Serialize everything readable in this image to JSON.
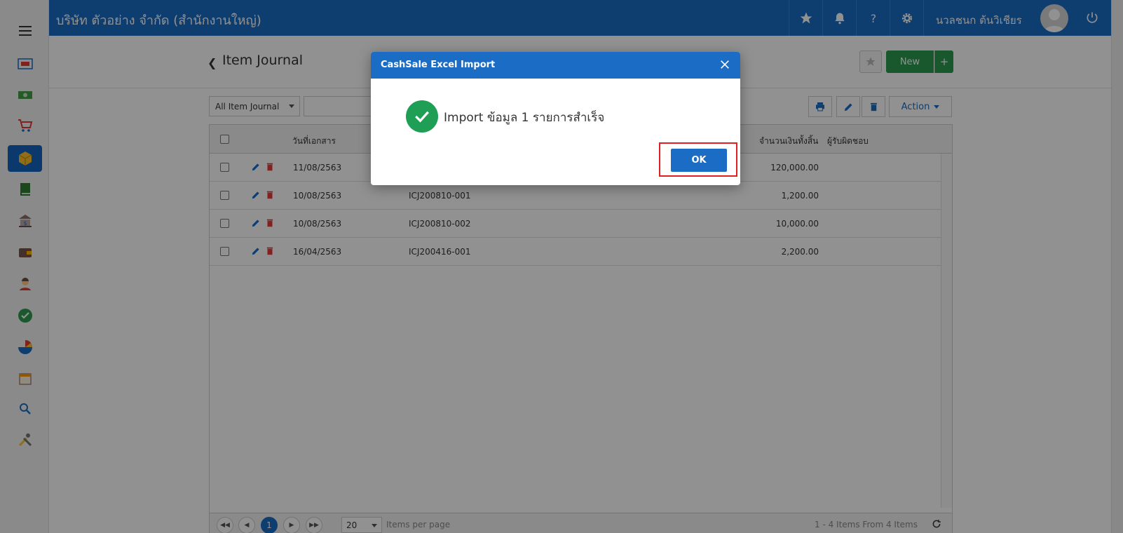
{
  "topbar": {
    "company": "บริษัท ตัวอย่าง จำกัด (สำนักงานใหญ่)",
    "username": "นวลชนก ต้นวิเชียร"
  },
  "sidebar": {
    "items": [
      {
        "icon": "dashboard-icon"
      },
      {
        "icon": "money-icon"
      },
      {
        "icon": "cart-icon"
      },
      {
        "icon": "box-icon",
        "active": true
      },
      {
        "icon": "book-icon"
      },
      {
        "icon": "bank-icon"
      },
      {
        "icon": "wallet-icon"
      },
      {
        "icon": "person-icon"
      },
      {
        "icon": "check-circle-icon"
      },
      {
        "icon": "chart-icon"
      },
      {
        "icon": "calendar-icon"
      },
      {
        "icon": "search-icon"
      },
      {
        "icon": "tools-icon"
      }
    ]
  },
  "header": {
    "title": "Item Journal",
    "new_label": "New",
    "plus_label": "+"
  },
  "toolbar": {
    "filter": "All Item Journal",
    "action_label": "Action"
  },
  "grid": {
    "columns": {
      "date": "วันที่เอกสาร",
      "total": "จำนวนเงินทั้งสิ้น",
      "owner": "ผู้รับผิดชอบ"
    },
    "rows": [
      {
        "date": "11/08/2563",
        "doc": "",
        "total": "120,000.00"
      },
      {
        "date": "10/08/2563",
        "doc": "ICJ200810-001",
        "total": "1,200.00"
      },
      {
        "date": "10/08/2563",
        "doc": "ICJ200810-002",
        "total": "10,000.00"
      },
      {
        "date": "16/04/2563",
        "doc": "ICJ200416-001",
        "total": "2,200.00"
      }
    ]
  },
  "pager": {
    "current_page": "1",
    "per_page": "20",
    "per_page_label": "Items per page",
    "summary": "1 - 4 Items From 4 Items"
  },
  "dialog": {
    "title": "CashSale Excel Import",
    "message": "Import ข้อมูล 1 รายการสำเร็จ",
    "ok_label": "OK"
  },
  "colors": {
    "primary": "#1a6cc4",
    "success": "#1f9f55",
    "new_button": "#2d9a4f",
    "highlight": "#e02020"
  }
}
